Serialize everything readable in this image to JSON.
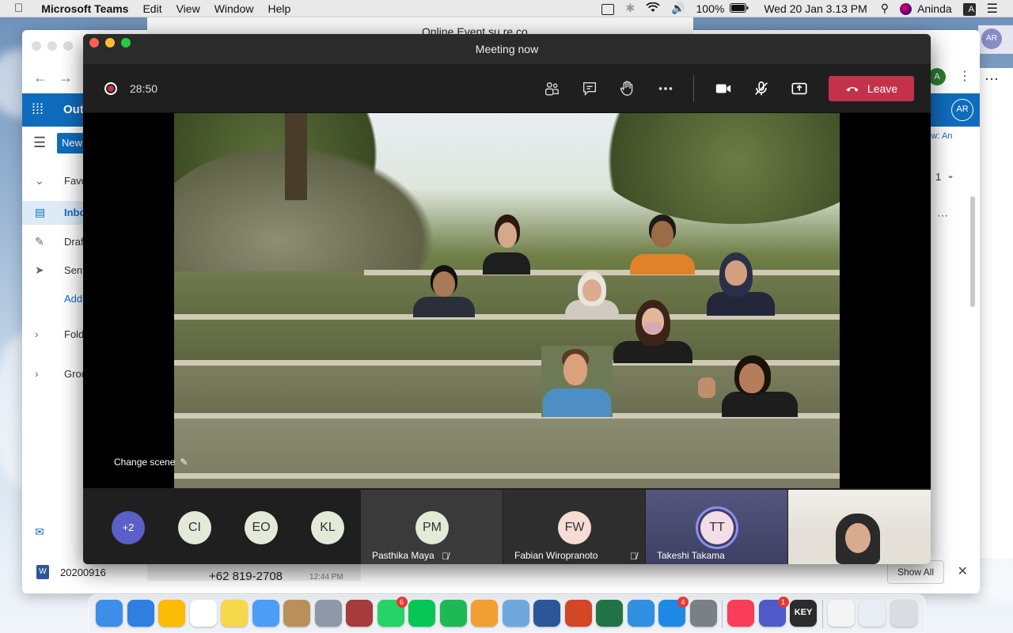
{
  "menubar": {
    "apple": "",
    "app_name": "Microsoft Teams",
    "menus": [
      "Edit",
      "View",
      "Window",
      "Help"
    ],
    "battery": "100%",
    "datetime": "Wed 20 Jan  3.13 PM",
    "user": "Aninda",
    "input_source": "A"
  },
  "outlook": {
    "app_label": "Out",
    "new_label": "New",
    "sidebar": [
      {
        "icon": "chevron-down-icon",
        "label": "Favo"
      },
      {
        "icon": "inbox-icon",
        "label": "Inbo"
      },
      {
        "icon": "pencil-icon",
        "label": "Draf"
      },
      {
        "icon": "send-icon",
        "label": "Sent"
      },
      {
        "icon": "",
        "label": "Add"
      },
      {
        "icon": "chevron-right-icon",
        "label": "Fold"
      },
      {
        "icon": "chevron-right-icon",
        "label": "Grou"
      }
    ],
    "right_text": "iew: An",
    "page_num": "1",
    "account_initial": "A",
    "account_initials": "AR"
  },
  "chat_peek": {
    "top_title": "Online Event su re co",
    "bottom_phone": "+62 819-2708",
    "bottom_time": "12:44 PM"
  },
  "teams_peek": {
    "avatar": "AR"
  },
  "download_bar": {
    "filename": "20200916",
    "show_all": "Show All"
  },
  "meeting": {
    "window_title": "Meeting now",
    "timer": "28:50",
    "leave_label": "Leave",
    "change_scene": "Change scene",
    "overflow_count": "+2",
    "small_avatars": [
      "CI",
      "EO",
      "KL"
    ],
    "tiles": [
      {
        "initials": "PM",
        "name": "Pasthika Maya",
        "muted": true,
        "bg": "#3a3a3a",
        "av": "#e3ead8"
      },
      {
        "initials": "FW",
        "name": "Fabian Wiropranoto",
        "muted": true,
        "bg": "#2e2e2e",
        "av": "#f6dcd4"
      },
      {
        "initials": "TT",
        "name": "Takeshi Takama",
        "muted": false,
        "bg": "#4a4b6e",
        "av": "#f3dde6"
      }
    ]
  },
  "dock": {
    "apps": [
      {
        "name": "finder-icon",
        "color": "#3d8ee8"
      },
      {
        "name": "safari-icon",
        "color": "#2f7fe0"
      },
      {
        "name": "chrome-icon",
        "color": "#fbbc05"
      },
      {
        "name": "reminders-icon",
        "color": "#ffffff"
      },
      {
        "name": "notes-icon",
        "color": "#f7d84a"
      },
      {
        "name": "messages-icon",
        "color": "#4c9df5"
      },
      {
        "name": "contacts-icon",
        "color": "#b9905a"
      },
      {
        "name": "launchpad-icon",
        "color": "#8e98a6"
      },
      {
        "name": "dictionary-icon",
        "color": "#a53b3b"
      },
      {
        "name": "whatsapp-icon",
        "color": "#25d366",
        "badge": "6"
      },
      {
        "name": "line-icon",
        "color": "#06c755"
      },
      {
        "name": "spotify-icon",
        "color": "#1db954"
      },
      {
        "name": "photos-icon",
        "color": "#f0a030"
      },
      {
        "name": "preview-icon",
        "color": "#6fa8dc"
      },
      {
        "name": "word-icon",
        "color": "#2b579a"
      },
      {
        "name": "powerpoint-icon",
        "color": "#d24726"
      },
      {
        "name": "excel-icon",
        "color": "#217346"
      },
      {
        "name": "keynote-icon",
        "color": "#2f8fe0"
      },
      {
        "name": "appstore-icon",
        "color": "#1e88e5",
        "badge": "4"
      },
      {
        "name": "system-preferences-icon",
        "color": "#7b7f86"
      },
      {
        "name": "music-icon",
        "color": "#fa3c5b"
      },
      {
        "name": "teams-icon",
        "color": "#5059c9",
        "badge": "1"
      },
      {
        "name": "keychain-icon",
        "color": "#2b2b2b",
        "label": "KEY"
      },
      {
        "name": "document-icon",
        "color": "#f4f4f4"
      },
      {
        "name": "screenshot-icon",
        "color": "#e8edf3"
      },
      {
        "name": "trash-icon",
        "color": "#d9dde2"
      }
    ]
  }
}
